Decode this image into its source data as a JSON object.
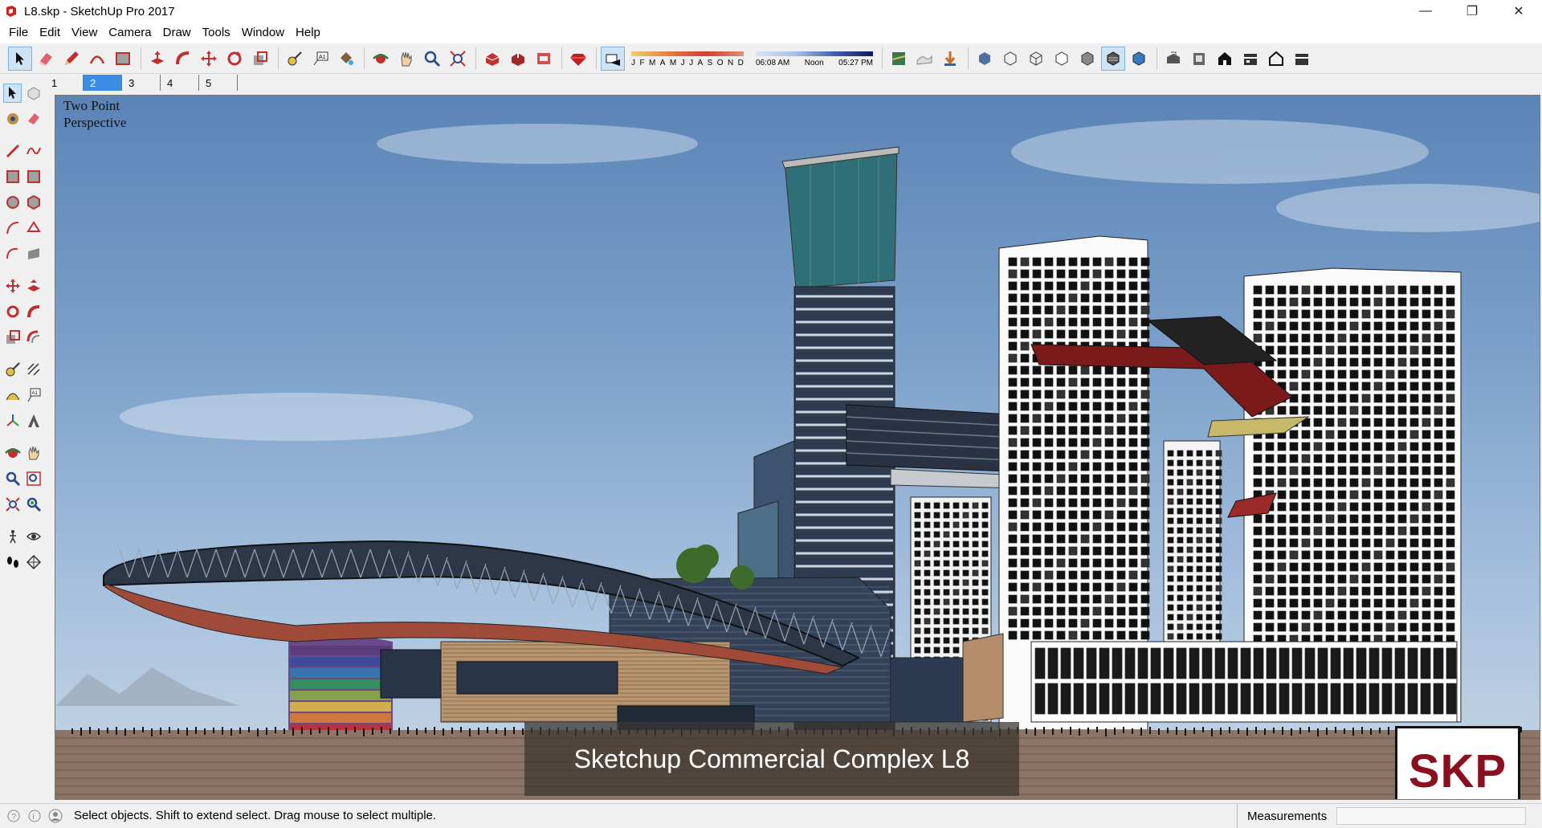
{
  "window": {
    "title": "L8.skp - SketchUp Pro 2017",
    "controls": {
      "minimize": "—",
      "maximize": "❐",
      "close": "✕"
    }
  },
  "menu": {
    "items": [
      "File",
      "Edit",
      "View",
      "Camera",
      "Draw",
      "Tools",
      "Window",
      "Help"
    ]
  },
  "toolbar": {
    "icons": [
      "select-icon",
      "eraser-icon",
      "pencil-icon",
      "arc-icon",
      "rectangle-icon",
      "push-pull-icon",
      "follow-me-icon",
      "move-icon",
      "rotate-icon",
      "scale-icon",
      "tape-measure-icon",
      "text-icon",
      "paint-bucket-icon",
      "orbit-icon",
      "pan-icon",
      "zoom-icon",
      "zoom-extents-icon",
      "warehouse-icon",
      "share-model-icon",
      "extension-warehouse-icon",
      "ruby-icon"
    ],
    "shadow_months": [
      "J",
      "F",
      "M",
      "A",
      "M",
      "J",
      "J",
      "A",
      "S",
      "O",
      "N",
      "D"
    ],
    "shadow_times": [
      "06:08 AM",
      "Noon",
      "05:27 PM"
    ],
    "views": [
      "iso-view-icon",
      "top-view-icon",
      "front-view-icon",
      "right-view-icon",
      "back-view-icon",
      "left-view-icon"
    ]
  },
  "scene_tabs": [
    {
      "label": "1",
      "active": false
    },
    {
      "label": "2",
      "active": true
    },
    {
      "label": "3",
      "active": false
    },
    {
      "label": "4",
      "active": false
    },
    {
      "label": "5",
      "active": false
    }
  ],
  "viewport": {
    "view_label_line1": "Two Point",
    "view_label_line2": "Perspective",
    "caption": "Sketchup Commercial Complex L8",
    "logo": "SKP"
  },
  "statusbar": {
    "message": "Select objects. Shift to extend select. Drag mouse to select multiple.",
    "measurements_label": "Measurements",
    "measurements_value": ""
  },
  "colors": {
    "accent": "#3c8ce6",
    "logo_red": "#8a1020",
    "bridge_red": "#7a1a1a"
  }
}
